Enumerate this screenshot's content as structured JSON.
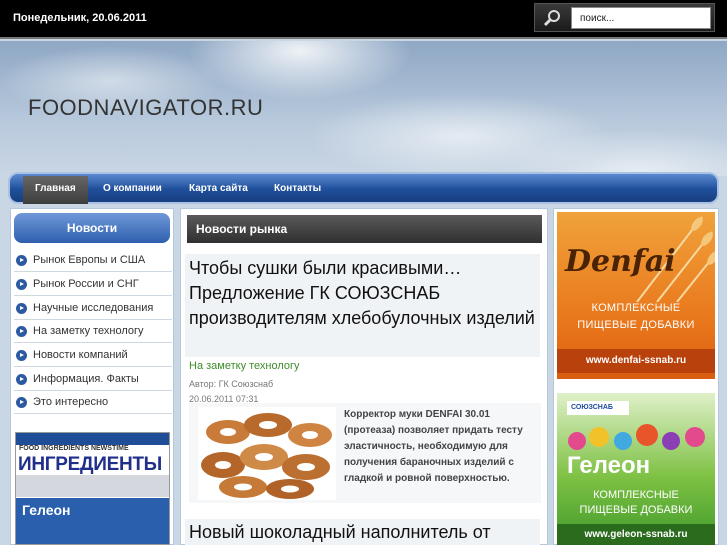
{
  "topbar": {
    "date": "Понедельник, 20.06.2011",
    "search_placeholder": "поиск..."
  },
  "header": {
    "site_title": "FOODNAVIGATOR.RU"
  },
  "nav": {
    "items": [
      {
        "label": "Главная",
        "active": true
      },
      {
        "label": "О компании",
        "active": false
      },
      {
        "label": "Карта сайта",
        "active": false
      },
      {
        "label": "Контакты",
        "active": false
      }
    ]
  },
  "sidebar": {
    "title": "Новости",
    "items": [
      {
        "label": "Рынок Европы и США"
      },
      {
        "label": "Рынок России и СНГ"
      },
      {
        "label": "Научные исследования"
      },
      {
        "label": "На заметку технологу"
      },
      {
        "label": "Новости компаний"
      },
      {
        "label": "Информация. Факты"
      },
      {
        "label": "Это интересно"
      }
    ],
    "magazine": {
      "top_line": "FOOD INGREDIENTS NEWSTIME",
      "title": "ИНГРЕДИЕНТЫ",
      "ad_name": "Гелеон"
    }
  },
  "main": {
    "section_title": "Новости рынка",
    "articles": [
      {
        "title": "Чтобы сушки были красивыми… Предложение ГК СОЮЗСНАБ производителям хлебобулочных изделий",
        "category": "На заметку технологу",
        "author": "Автор: ГК Союзснаб",
        "date": "20.06.2011 07:31",
        "text": "Корректор муки DENFAI 30.01 (протеаза) позволяет придать тесту эластичность, необходимую для получения бараночных изделий с гладкой и ровной поверхностью."
      },
      {
        "title": "Новый шоколадный наполнитель от"
      }
    ]
  },
  "ads": {
    "ad1": {
      "brand": "Denfai",
      "text_line1": "КОМПЛЕКСНЫЕ",
      "text_line2": "ПИЩЕВЫЕ ДОБАВКИ",
      "url": "www.denfai-ssnab.ru"
    },
    "ad2": {
      "logo": "СОЮЗСНАБ",
      "brand": "Гелеон",
      "text_line1": "КОМПЛЕКСНЫЕ",
      "text_line2": "ПИЩЕВЫЕ ДОБАВКИ",
      "url": "www.geleon-ssnab.ru"
    }
  },
  "colors": {
    "nav_blue": "#2e5fae",
    "category_green": "#3f8d2a",
    "ad1_orange": "#e8741a",
    "ad2_green": "#7ec144"
  }
}
